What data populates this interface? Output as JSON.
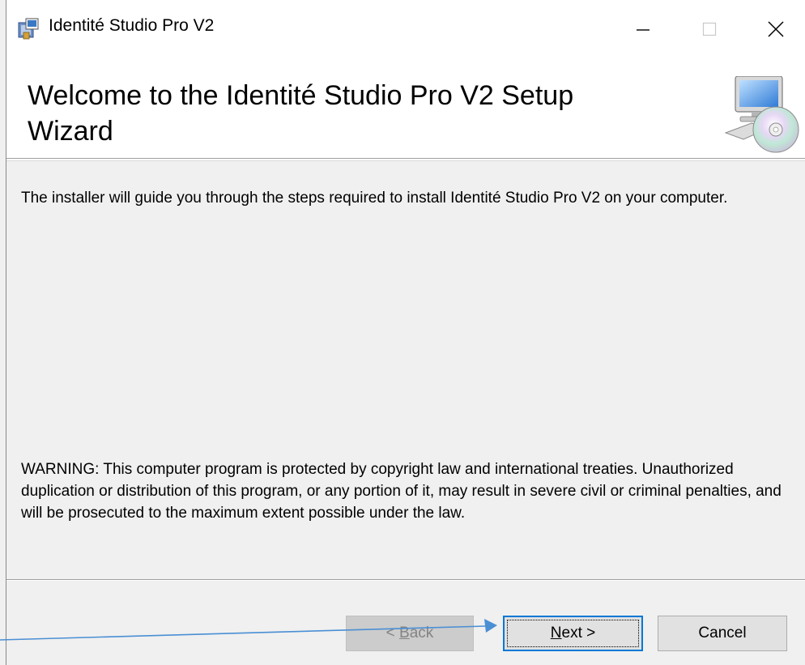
{
  "window": {
    "title": "Identité Studio Pro V2",
    "icon": "installer-package-icon",
    "controls": {
      "minimize_icon": "minimize-icon",
      "maximize_icon": "maximize-icon",
      "close_icon": "close-icon"
    }
  },
  "banner": {
    "title": "Welcome to the Identité Studio Pro V2 Setup Wizard",
    "icon": "computer-cd-icon"
  },
  "body": {
    "intro": "The installer will guide you through the steps required to install Identité Studio Pro V2 on your computer.",
    "warning": "WARNING: This computer program is protected by copyright law and international treaties. Unauthorized duplication or distribution of this program, or any portion of it, may result in severe civil or criminal penalties, and will be prosecuted to the maximum extent possible under the law."
  },
  "buttons": {
    "back": {
      "prefix": "< ",
      "accel": "B",
      "rest": "ack",
      "enabled": false
    },
    "next": {
      "accel": "N",
      "rest": "ext >",
      "focused": true
    },
    "cancel": {
      "label": "Cancel"
    }
  },
  "colors": {
    "focus_border": "#0078d7",
    "annotation_arrow": "#4a8fd4",
    "dialog_background": "#f0f0f0"
  }
}
